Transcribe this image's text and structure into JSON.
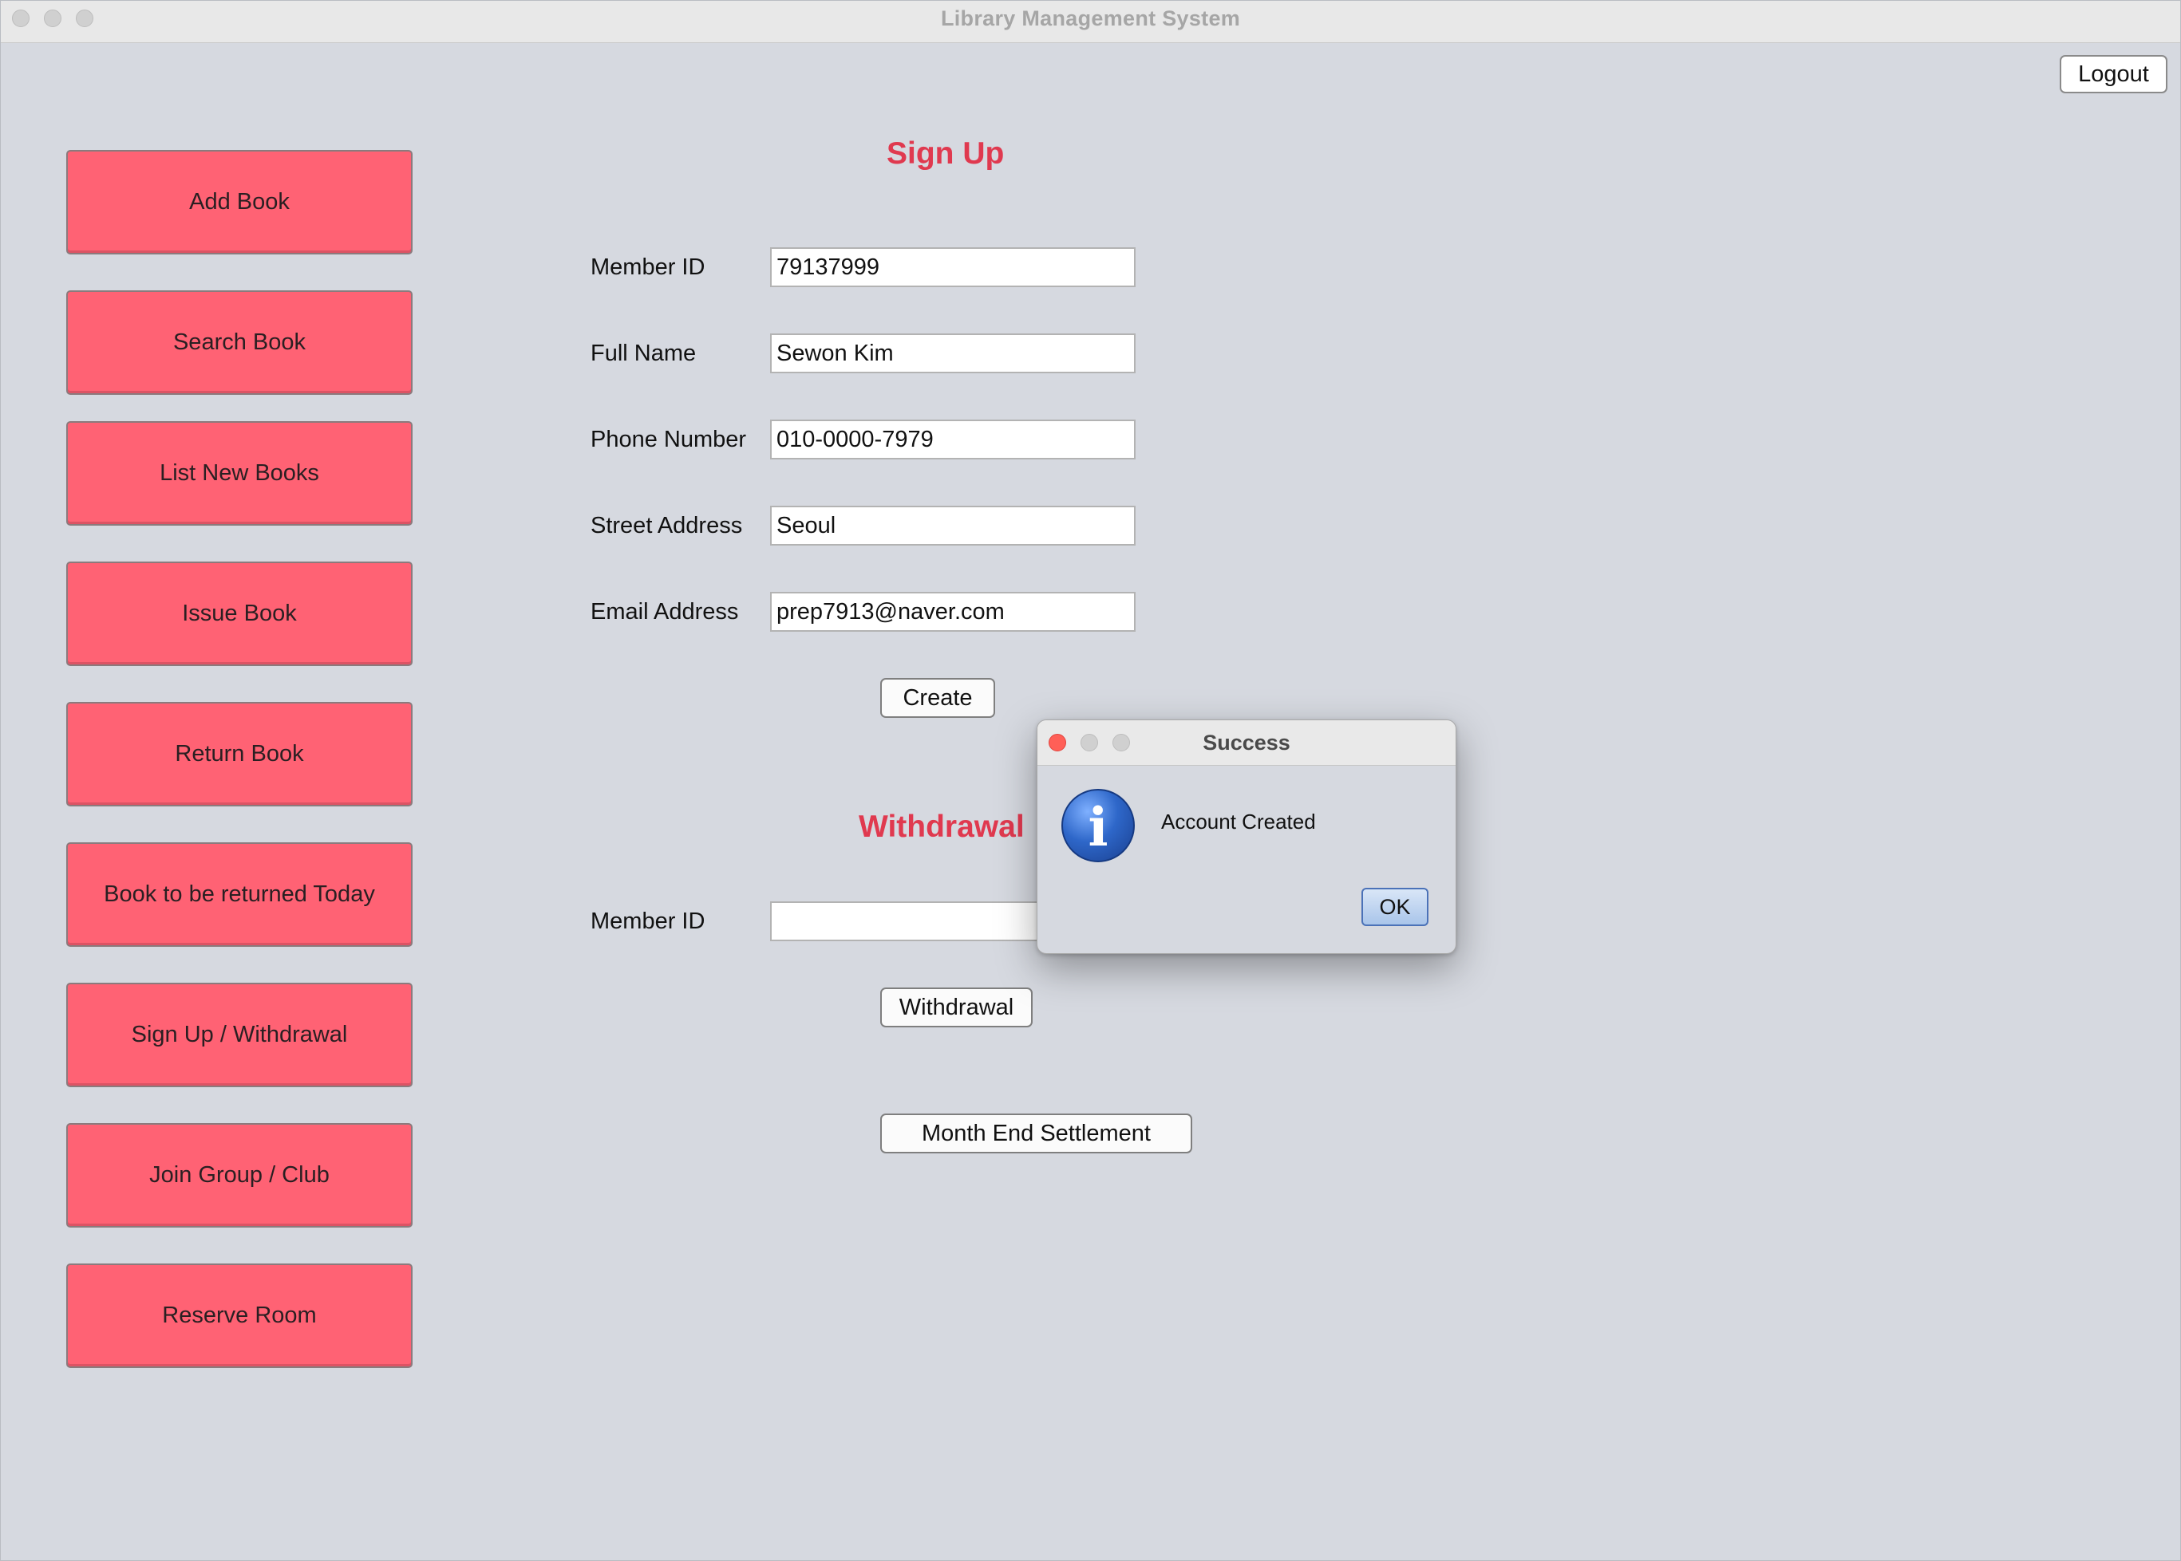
{
  "window": {
    "title": "Library Management System"
  },
  "header": {
    "logout_label": "Logout"
  },
  "sidebar": {
    "items": [
      {
        "label": "Add Book"
      },
      {
        "label": "Search Book"
      },
      {
        "label": "List New Books"
      },
      {
        "label": "Issue Book"
      },
      {
        "label": "Return Book"
      },
      {
        "label": "Book to be returned Today"
      },
      {
        "label": "Sign Up / Withdrawal"
      },
      {
        "label": "Join Group / Club"
      },
      {
        "label": "Reserve Room"
      }
    ]
  },
  "signup": {
    "title": "Sign Up",
    "member_id_label": "Member ID",
    "member_id_value": "79137999",
    "full_name_label": "Full Name",
    "full_name_value": "Sewon Kim",
    "phone_label": "Phone Number",
    "phone_value": "010-0000-7979",
    "street_label": "Street Address",
    "street_value": "Seoul",
    "email_label": "Email Address",
    "email_value": "prep7913@naver.com",
    "create_label": "Create"
  },
  "withdrawal": {
    "title": "Withdrawal",
    "member_id_label": "Member ID",
    "member_id_value": "",
    "withdrawal_label": "Withdrawal"
  },
  "settlement": {
    "label": "Month End Settlement"
  },
  "dialog": {
    "title": "Success",
    "icon": "info-icon",
    "icon_glyph": "i",
    "message": "Account Created",
    "ok_label": "OK"
  },
  "colors": {
    "sidebar_button": "#ff6274",
    "section_title": "#e0394f",
    "window_background": "#d6d9e0"
  }
}
